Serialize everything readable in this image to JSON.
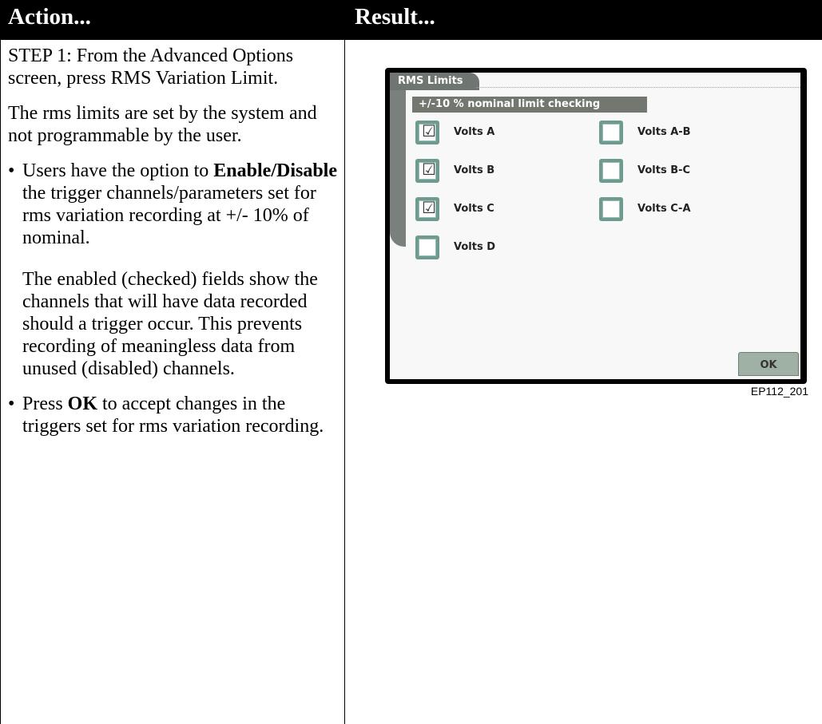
{
  "header": {
    "action": "Action...",
    "result": "Result..."
  },
  "action": {
    "step": "STEP 1: From the Advanced Options screen, press RMS Variation Limit.",
    "note": "The rms limits are set by the system and not programmable by the user.",
    "bullet1": {
      "pre": "Users have the option to ",
      "bold": "Enable/Disable",
      "post": " the trigger channels/parameters set for rms variation recording at +/- 10% of nominal."
    },
    "bullet1_sub": "The enabled (checked) fields show the channels that will have data recorded should a trigger occur. This prevents recording of meaningless data from unused (disabled) channels.",
    "bullet2": {
      "pre": "Press ",
      "bold": "OK",
      "post": " to accept changes in the triggers set for rms variation recording."
    },
    "bullet_glyph": "•"
  },
  "screen": {
    "tab": "RMS Limits",
    "limit_bar": "+/-10 % nominal limit checking",
    "check_mark": "☑",
    "checkboxes": [
      {
        "label": "Volts A",
        "checked": true
      },
      {
        "label": "Volts B",
        "checked": true
      },
      {
        "label": "Volts C",
        "checked": true
      },
      {
        "label": "Volts D",
        "checked": false
      },
      {
        "label": "Volts A-B",
        "checked": false
      },
      {
        "label": "Volts B-C",
        "checked": false
      },
      {
        "label": "Volts C-A",
        "checked": false
      }
    ],
    "ok": "OK"
  },
  "caption": "EP112_201"
}
